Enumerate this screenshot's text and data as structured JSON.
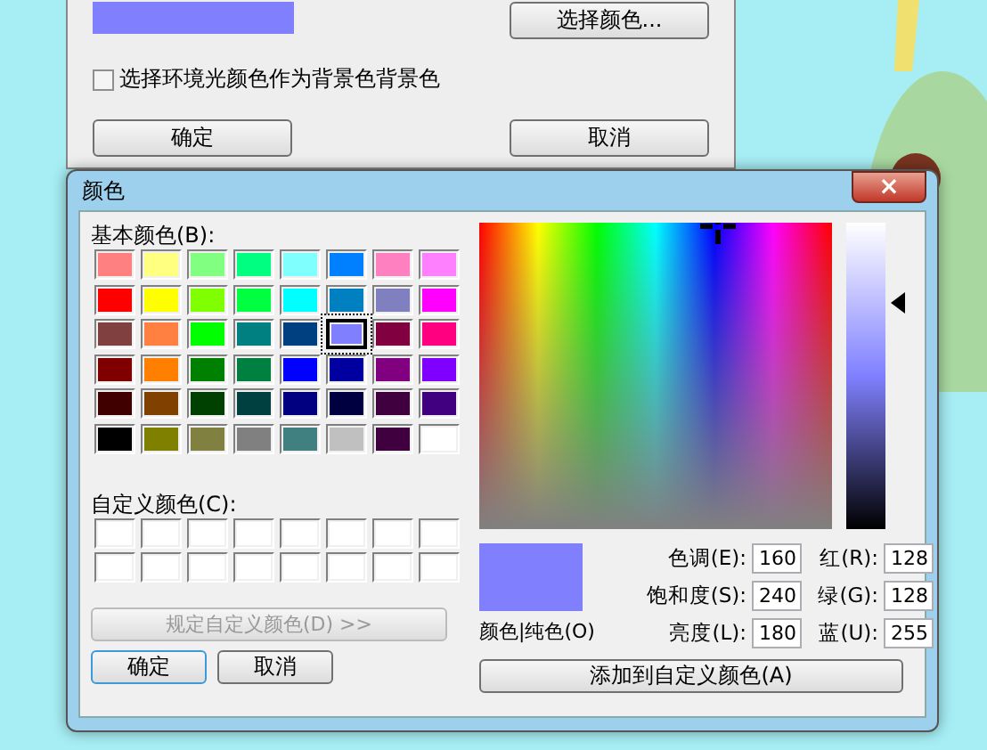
{
  "parent_dialog": {
    "preview": {
      "color": "#8080ff"
    },
    "choose_button": "选择颜色...",
    "ambient_checkbox": {
      "label": "选择环境光颜色作为背景色背景色",
      "checked": false
    },
    "ok_button": "确定",
    "cancel_button": "取消"
  },
  "color_dialog": {
    "title": "颜色",
    "close_button": "×",
    "basic_label": "基本颜色(B):",
    "basic_colors": [
      {
        "color": "#ff8080",
        "selected": false
      },
      {
        "color": "#ffff80",
        "selected": false
      },
      {
        "color": "#80ff80",
        "selected": false
      },
      {
        "color": "#00ff80",
        "selected": false
      },
      {
        "color": "#80ffff",
        "selected": false
      },
      {
        "color": "#0080ff",
        "selected": false
      },
      {
        "color": "#ff80c0",
        "selected": false
      },
      {
        "color": "#ff80ff",
        "selected": false
      },
      {
        "color": "#ff0000",
        "selected": false
      },
      {
        "color": "#ffff00",
        "selected": false
      },
      {
        "color": "#80ff00",
        "selected": false
      },
      {
        "color": "#00ff40",
        "selected": false
      },
      {
        "color": "#00ffff",
        "selected": false
      },
      {
        "color": "#0080c0",
        "selected": false
      },
      {
        "color": "#8080c0",
        "selected": false
      },
      {
        "color": "#ff00ff",
        "selected": false
      },
      {
        "color": "#804040",
        "selected": false
      },
      {
        "color": "#ff8040",
        "selected": false
      },
      {
        "color": "#00ff00",
        "selected": false
      },
      {
        "color": "#008080",
        "selected": false
      },
      {
        "color": "#004080",
        "selected": false
      },
      {
        "color": "#8080ff",
        "selected": true
      },
      {
        "color": "#800040",
        "selected": false
      },
      {
        "color": "#ff0080",
        "selected": false
      },
      {
        "color": "#800000",
        "selected": false
      },
      {
        "color": "#ff8000",
        "selected": false
      },
      {
        "color": "#008000",
        "selected": false
      },
      {
        "color": "#008040",
        "selected": false
      },
      {
        "color": "#0000ff",
        "selected": false
      },
      {
        "color": "#0000a0",
        "selected": false
      },
      {
        "color": "#800080",
        "selected": false
      },
      {
        "color": "#8000ff",
        "selected": false
      },
      {
        "color": "#400000",
        "selected": false
      },
      {
        "color": "#804000",
        "selected": false
      },
      {
        "color": "#004000",
        "selected": false
      },
      {
        "color": "#004040",
        "selected": false
      },
      {
        "color": "#000080",
        "selected": false
      },
      {
        "color": "#000040",
        "selected": false
      },
      {
        "color": "#400040",
        "selected": false
      },
      {
        "color": "#400080",
        "selected": false
      },
      {
        "color": "#000000",
        "selected": false
      },
      {
        "color": "#808000",
        "selected": false
      },
      {
        "color": "#808040",
        "selected": false
      },
      {
        "color": "#808080",
        "selected": false
      },
      {
        "color": "#408080",
        "selected": false
      },
      {
        "color": "#c0c0c0",
        "selected": false
      },
      {
        "color": "#400040",
        "selected": false
      },
      {
        "color": "#ffffff",
        "selected": false
      }
    ],
    "custom_label": "自定义颜色(C):",
    "custom_colors": [
      {
        "color": "#ffffff"
      },
      {
        "color": "#ffffff"
      },
      {
        "color": "#ffffff"
      },
      {
        "color": "#ffffff"
      },
      {
        "color": "#ffffff"
      },
      {
        "color": "#ffffff"
      },
      {
        "color": "#ffffff"
      },
      {
        "color": "#ffffff"
      },
      {
        "color": "#ffffff"
      },
      {
        "color": "#ffffff"
      },
      {
        "color": "#ffffff"
      },
      {
        "color": "#ffffff"
      },
      {
        "color": "#ffffff"
      },
      {
        "color": "#ffffff"
      },
      {
        "color": "#ffffff"
      },
      {
        "color": "#ffffff"
      }
    ],
    "define_button": {
      "label": "规定自定义颜色(D) >>",
      "disabled": true
    },
    "ok_button": "确定",
    "cancel_button": "取消",
    "preview": {
      "color": "#8080ff"
    },
    "preview_label": "颜色|纯色(O)",
    "fields": [
      {
        "label": "色调(E):",
        "value": "160"
      },
      {
        "label": "红(R):",
        "value": "128"
      },
      {
        "label": "饱和度(S):",
        "value": "240"
      },
      {
        "label": "绿(G):",
        "value": "128"
      },
      {
        "label": "亮度(L):",
        "value": "180"
      },
      {
        "label": "蓝(U):",
        "value": "255"
      }
    ],
    "add_button": "添加到自定义颜色(A)"
  }
}
